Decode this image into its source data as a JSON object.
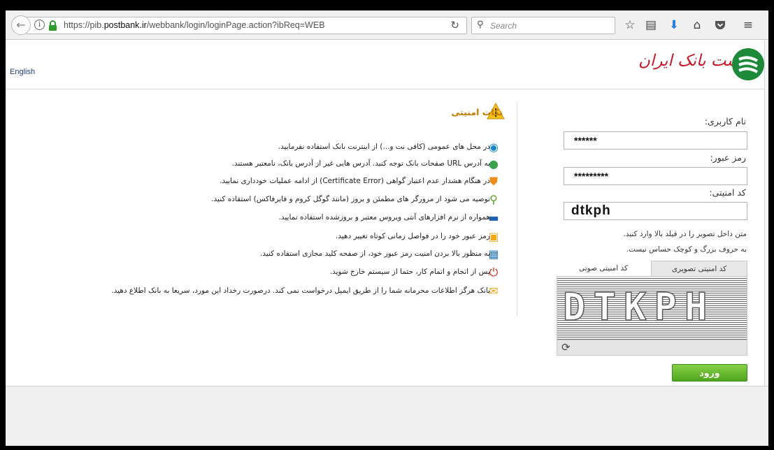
{
  "browser": {
    "url_prefix": "https://pib.",
    "url_domain": "postbank.ir",
    "url_path": "/webbank/login/loginPage.action?ibReq=WEB",
    "search_placeholder": "Search"
  },
  "header": {
    "language_link": "English",
    "logo_text": "پست بانک ایران"
  },
  "security_tips": {
    "title": "نکات امنیتی",
    "items": [
      {
        "icon": "wifi-icon",
        "color": "#1b86c9",
        "text": "در محل های عمومی (کافی نت و...) از اینترنت بانک استفاده نفرمایید."
      },
      {
        "icon": "globe-icon",
        "color": "#3aa34a",
        "text": "به آدرس URL صفحات بانک توجه کنید. آدرس هایی غیر از آدرس بانک، نامعتبر هستند."
      },
      {
        "icon": "shield-icon",
        "color": "#f08c1a",
        "text": "در هنگام هشدار عدم اعتبار گواهی (Certificate Error) از ادامه عملیات خودداری نمایید."
      },
      {
        "icon": "magnifier-icon",
        "color": "#5aa02c",
        "text": "توصیه می شود از مرورگر های مطمئن و بروز (مانند گوگل کروم و فایرفاکس) استفاده کنید."
      },
      {
        "icon": "laptop-icon",
        "color": "#1f5fb4",
        "text": "همواره از نرم افزارهای آنتی ویروس معتبر و بروزشده استفاده نمایید."
      },
      {
        "icon": "padlock-icon",
        "color": "#f0a818",
        "text": "رمز عبور خود را در فواصل زمانی کوتاه تغییر دهید."
      },
      {
        "icon": "keyboard-icon",
        "color": "#2b78c2",
        "text": "به منظور بالا بردن امنیت رمز عبور خود، از صفحه کلید مجازی استفاده کنید."
      },
      {
        "icon": "power-icon",
        "color": "#d8261b",
        "text": "پس از انجام و اتمام کار، حتما از سیستم خارج شوید."
      },
      {
        "icon": "envelope-icon",
        "color": "#f2a31c",
        "text": "بانک هرگز اطلاعات محرمانه شما را از طریق ایمیل درخواست نمی کند. درصورت رخداد این مورد، سریعا به بانک اطلاع دهید."
      }
    ]
  },
  "login_form": {
    "username_label": "نام کاربری:",
    "username_value": "******",
    "password_label": "رمز عبور:",
    "password_value": "*********",
    "captcha_label": "کد امنیتی:",
    "captcha_value": "dtkph",
    "help_line1": "متن داخل تصویر را در فیلد بالا وارد کنید.",
    "help_line2": "به حروف بزرگ و کوچک حساس نیست.",
    "tab_image": "کد امنیتی تصویری",
    "tab_audio": "کد امنیتی صوتی",
    "captcha_image_text": "DTKPH",
    "login_button": "ورود"
  }
}
